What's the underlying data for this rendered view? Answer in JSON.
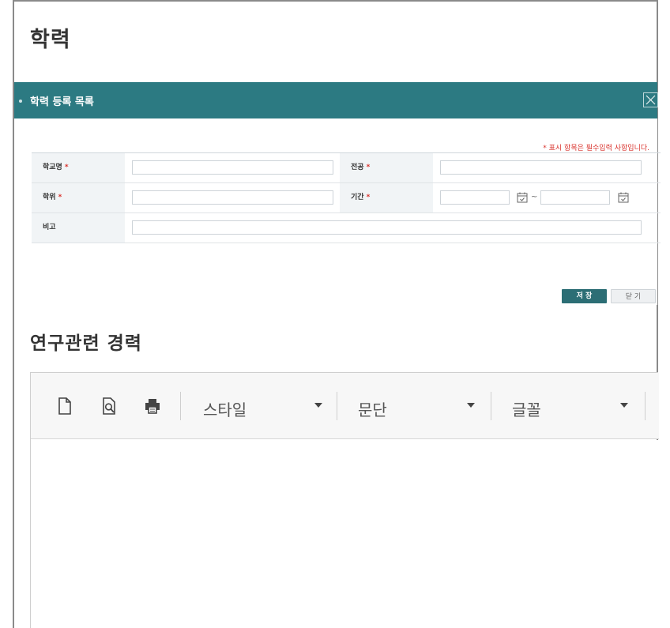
{
  "page": {
    "title": "학력"
  },
  "modal": {
    "title": "학력 등록 목록",
    "required_note": "* 표시 항목은 필수입력 사항입니다.",
    "fields": {
      "school_label": "학교명",
      "major_label": "전공",
      "degree_label": "학위",
      "period_label": "기간",
      "remarks_label": "비고",
      "required_mark": "*",
      "tilde": "~",
      "school_value": "",
      "major_value": "",
      "degree_value": "",
      "period_start": "",
      "period_end": "",
      "remarks_value": ""
    },
    "buttons": {
      "save": "저 장",
      "close": "닫 기"
    }
  },
  "research": {
    "title": "연구관련 경력",
    "toolbar": {
      "style_label": "스타일",
      "paragraph_label": "문단",
      "font_label": "글꼴"
    }
  },
  "colors": {
    "header": "#2c7a82",
    "save_button": "#2c6e75",
    "required": "#d9312b"
  }
}
